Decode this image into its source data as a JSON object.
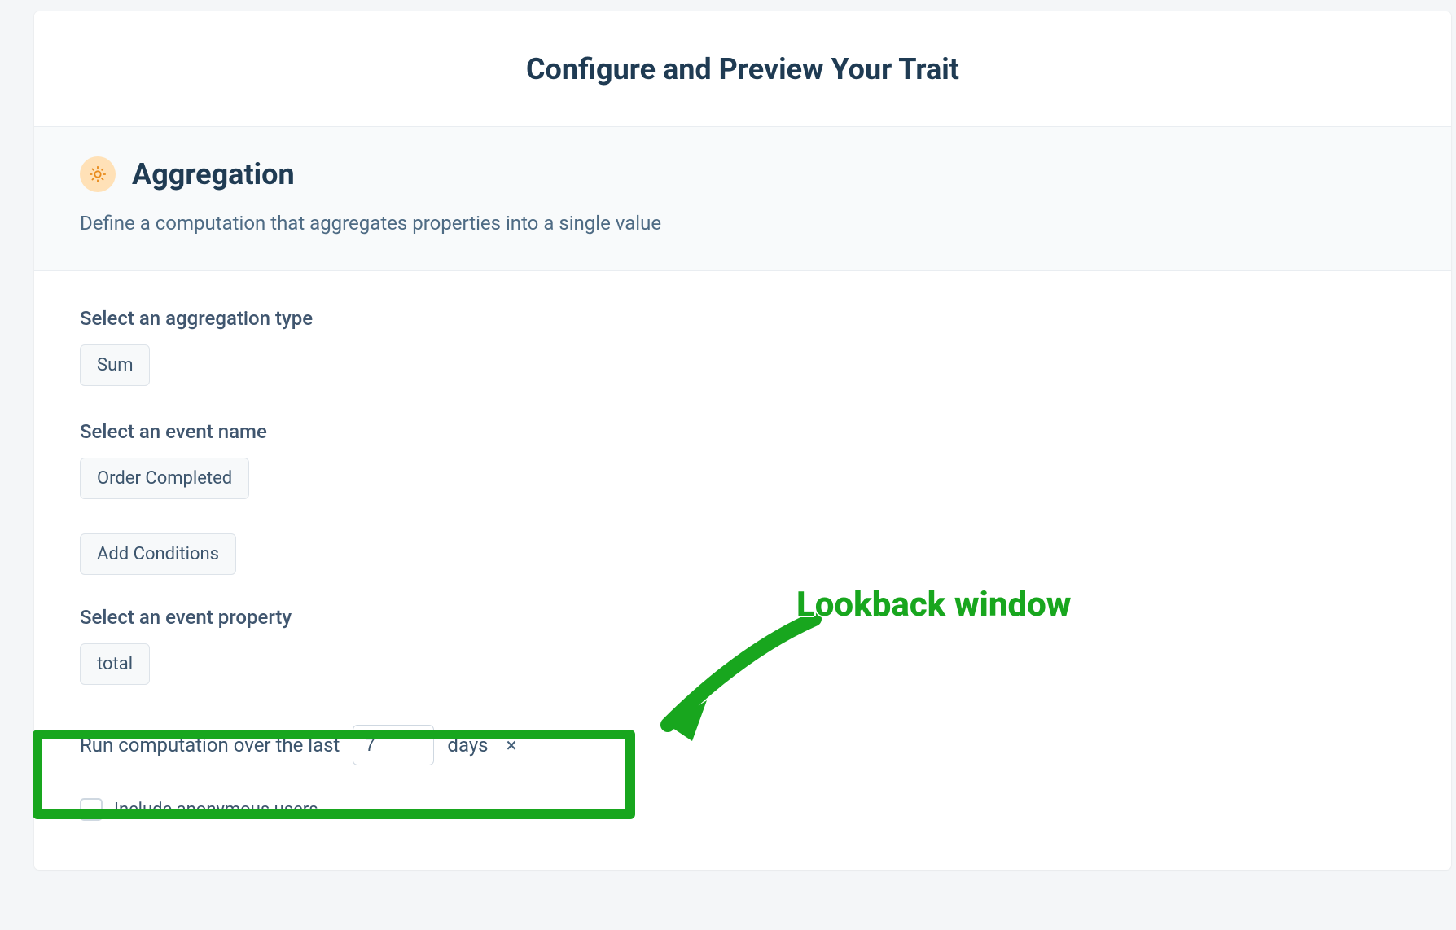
{
  "header": {
    "title": "Configure and Preview Your Trait"
  },
  "section": {
    "title": "Aggregation",
    "subtitle": "Define a computation that aggregates properties into a single value"
  },
  "form": {
    "agg_type_label": "Select an aggregation type",
    "agg_type_value": "Sum",
    "event_name_label": "Select an event name",
    "event_name_value": "Order Completed",
    "add_conditions_label": "Add Conditions",
    "event_property_label": "Select an event property",
    "event_property_value": "total",
    "lookback_prefix": "Run computation over the last",
    "lookback_value": "7",
    "lookback_unit": "days",
    "lookback_clear": "×",
    "anon_label": "Include anonymous users"
  },
  "annotation": {
    "label": "Lookback window"
  },
  "colors": {
    "accent_green": "#18a61e",
    "text_primary": "#1f3b53",
    "text_secondary": "#4e6b84",
    "gear_bg": "#ffe1b7",
    "gear_fg": "#e88a1a"
  }
}
